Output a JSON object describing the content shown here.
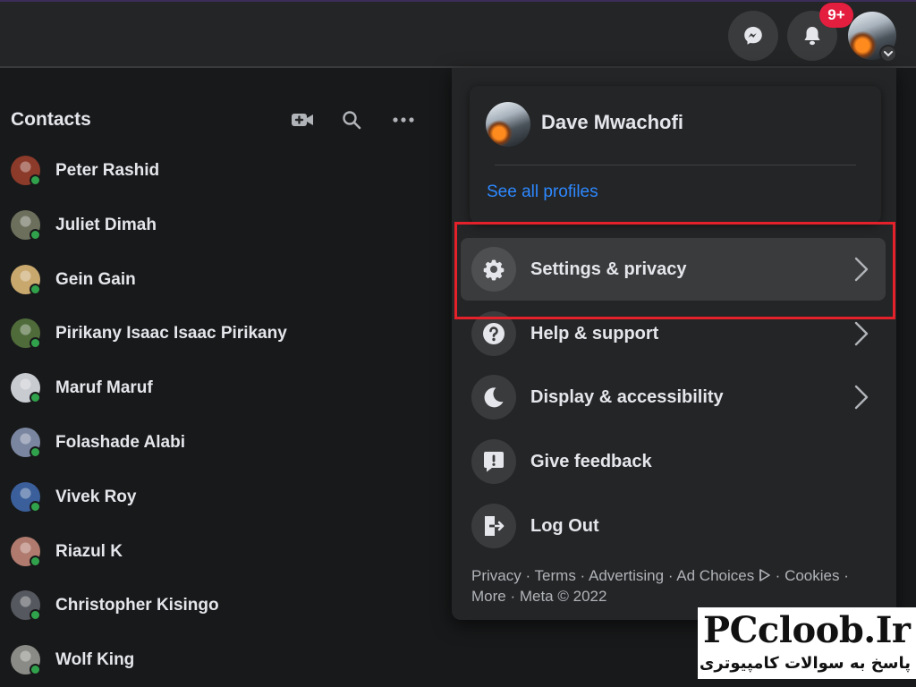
{
  "header": {
    "notification_count": "9+",
    "icons": [
      "messenger-icon",
      "bell-icon",
      "chevron-down-icon"
    ]
  },
  "contacts": {
    "title": "Contacts",
    "items": [
      {
        "name": "Peter Rashid",
        "avatar": "#8c3a2a",
        "online": true
      },
      {
        "name": "Juliet Dimah",
        "avatar": "#6b6f5c",
        "online": true
      },
      {
        "name": "Gein Gain",
        "avatar": "#c9a86e",
        "online": true
      },
      {
        "name": "Pirikany Isaac Isaac Pirikany",
        "avatar": "#4f6b3a",
        "online": true
      },
      {
        "name": "Maruf Maruf",
        "avatar": "#c8cbd0",
        "online": true
      },
      {
        "name": "Folashade Alabi",
        "avatar": "#7a86a0",
        "online": true
      },
      {
        "name": "Vivek Roy",
        "avatar": "#3a5f9a",
        "online": true
      },
      {
        "name": "Riazul K",
        "avatar": "#b07a6e",
        "online": true
      },
      {
        "name": "Christopher Kisingo",
        "avatar": "#55585e",
        "online": true
      },
      {
        "name": "Wolf King",
        "avatar": "#8a8a86",
        "online": true
      }
    ]
  },
  "account_menu": {
    "profile_name": "Dave Mwachofi",
    "see_all_profiles": "See all profiles",
    "items": [
      {
        "label": "Settings & privacy",
        "icon": "gear-icon",
        "has_chevron": true,
        "active": true
      },
      {
        "label": "Help & support",
        "icon": "question-icon",
        "has_chevron": true,
        "active": false
      },
      {
        "label": "Display & accessibility",
        "icon": "moon-icon",
        "has_chevron": true,
        "active": false
      },
      {
        "label": "Give feedback",
        "icon": "feedback-icon",
        "has_chevron": false,
        "active": false
      },
      {
        "label": "Log Out",
        "icon": "logout-icon",
        "has_chevron": false,
        "active": false
      }
    ],
    "footer": {
      "links": [
        "Privacy",
        "Terms",
        "Advertising",
        "Ad Choices",
        "Cookies",
        "More"
      ],
      "copyright": "Meta © 2022"
    }
  },
  "watermark": {
    "title": "PCcloob.Ir",
    "subtitle": "پاسخ به سوالات کامپیوتری"
  },
  "colors": {
    "background": "#18191a",
    "surface": "#242526",
    "hover": "#3a3b3c",
    "link": "#2d88ff",
    "online": "#31a24c",
    "badge": "#e41e3f",
    "highlight_box": "#e3212a"
  }
}
